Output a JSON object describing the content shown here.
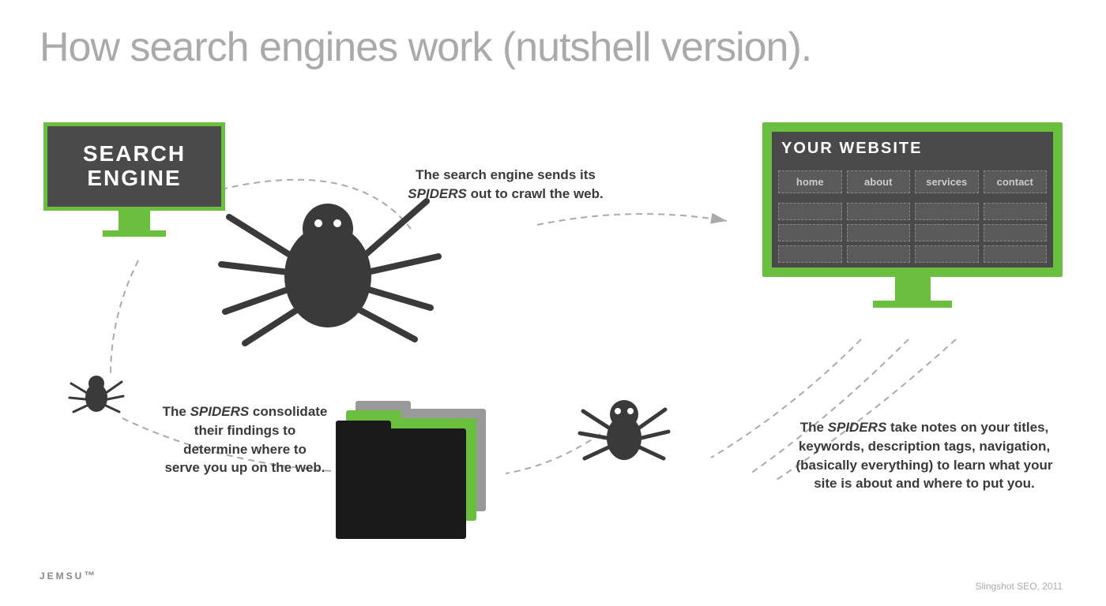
{
  "title": "How search engines work (nutshell version).",
  "search_engine_monitor": {
    "label_line1": "SEARCH",
    "label_line2": "ENGINE"
  },
  "website_monitor": {
    "title": "YOUR WEBSITE",
    "nav_items": [
      "home",
      "about",
      "services",
      "contact"
    ]
  },
  "annotations": {
    "top_center": "The search engine sends its\nSPIDERS out to crawl the web.",
    "bottom_left": "The SPIDERS consolidate\ntheir findings to\ndetermine where to\nserve you up on the web.",
    "bottom_right": "The SPIDERS take notes on your titles,\nkeywords, description tags, navigation,\n(basically everything) to learn what your\nsite is about and where to put you."
  },
  "logo": {
    "text": "JEMSU",
    "trademark": "™"
  },
  "attribution": {
    "text": "Slingshot SEO, 2011"
  },
  "colors": {
    "green": "#6abf3e",
    "dark": "#4a4a4a",
    "medium": "#5a5a5a",
    "text": "#3a3a3a",
    "light_text": "#aaaaaa",
    "white": "#ffffff",
    "dashed_line": "#aaaaaa"
  }
}
